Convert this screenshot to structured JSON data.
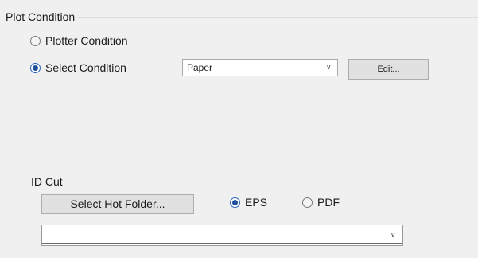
{
  "plot_condition": {
    "title": "Plot Condition",
    "option_plotter": {
      "label": "Plotter Condition",
      "checked": false
    },
    "option_select": {
      "label": "Select Condition",
      "checked": true
    },
    "condition_select": {
      "value": "Paper"
    },
    "edit_button": {
      "label": "Edit..."
    }
  },
  "id_cut": {
    "title": "ID Cut",
    "hot_folder_button": {
      "label": "Select Hot Folder..."
    },
    "format_eps": {
      "label": "EPS",
      "checked": true
    },
    "format_pdf": {
      "label": "PDF",
      "checked": false
    },
    "path_field": {
      "value": ""
    }
  },
  "icons": {
    "dropdown": "chevron-down-icon"
  },
  "colors": {
    "window_bg": "#f0f0f0",
    "radio_checked": "#1d4f9c",
    "button_bg": "#e1e1e1"
  }
}
